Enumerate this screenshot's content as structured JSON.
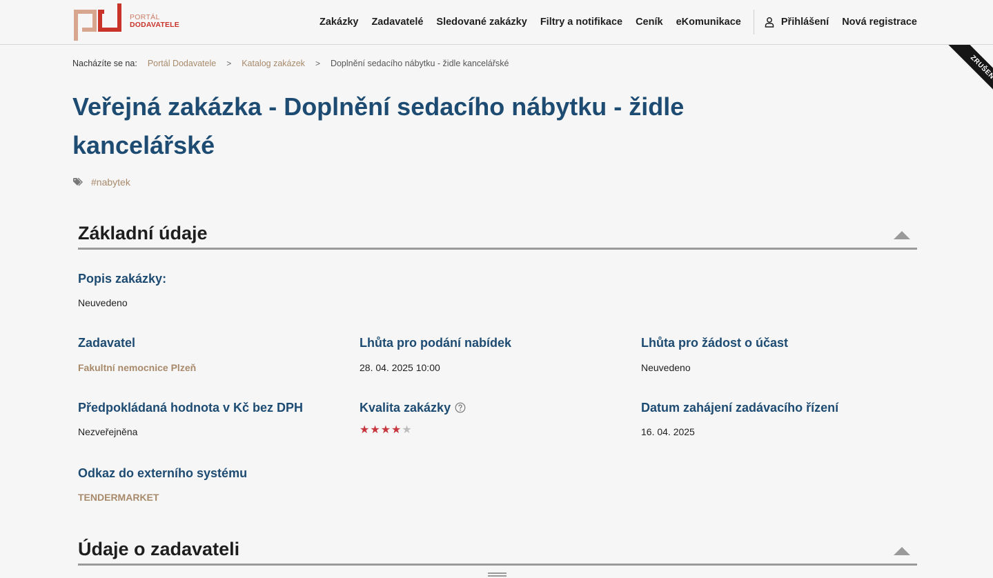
{
  "logo": {
    "line1": "PORTÁL",
    "line2": "DODAVATELE"
  },
  "nav": {
    "items": [
      "Zakázky",
      "Zadavatelé",
      "Sledované zakázky",
      "Filtry a notifikace",
      "Ceník",
      "eKomunikace"
    ],
    "login": "Přihlášení",
    "register": "Nová registrace"
  },
  "corner_banner": "ZRUŠENO",
  "breadcrumb": {
    "label": "Nacházíte se na:",
    "items": [
      "Portál Dodavatele",
      "Katalog zakázek"
    ],
    "current": "Doplnění sedacího nábytku - židle kancelářské",
    "separator": ">"
  },
  "title": "Veřejná zakázka - Doplnění sedacího nábytku - židle kancelářské",
  "tags": [
    "#nabytek"
  ],
  "sections": {
    "basic": {
      "heading": "Základní údaje",
      "description_label": "Popis zakázky:",
      "description_value": "Neuvedeno",
      "contracting_authority_label": "Zadavatel",
      "contracting_authority_value": "Fakultní nemocnice Plzeň",
      "offer_deadline_label": "Lhůta pro podání nabídek",
      "offer_deadline_value": "28. 04. 2025 10:00",
      "participation_deadline_label": "Lhůta pro žádost o účast",
      "participation_deadline_value": "Neuvedeno",
      "estimated_value_label": "Předpokládaná hodnota v Kč bez DPH",
      "estimated_value_value": "Nezveřejněna",
      "quality_label": "Kvalita zakázky",
      "quality_rating": 4,
      "quality_max": 5,
      "start_date_label": "Datum zahájení zadávacího řízení",
      "start_date_value": "16. 04. 2025",
      "external_link_label": "Odkaz do externího systému",
      "external_link_value": "TENDERMARKET"
    },
    "authority": {
      "heading": "Údaje o zadavateli"
    }
  },
  "colors": {
    "title": "#1d4b72",
    "link": "#a88a6b",
    "star_on": "#c7353d",
    "star_off": "#bdbdbd",
    "logo_red": "#c9332a",
    "logo_tan": "#d8a58f"
  }
}
